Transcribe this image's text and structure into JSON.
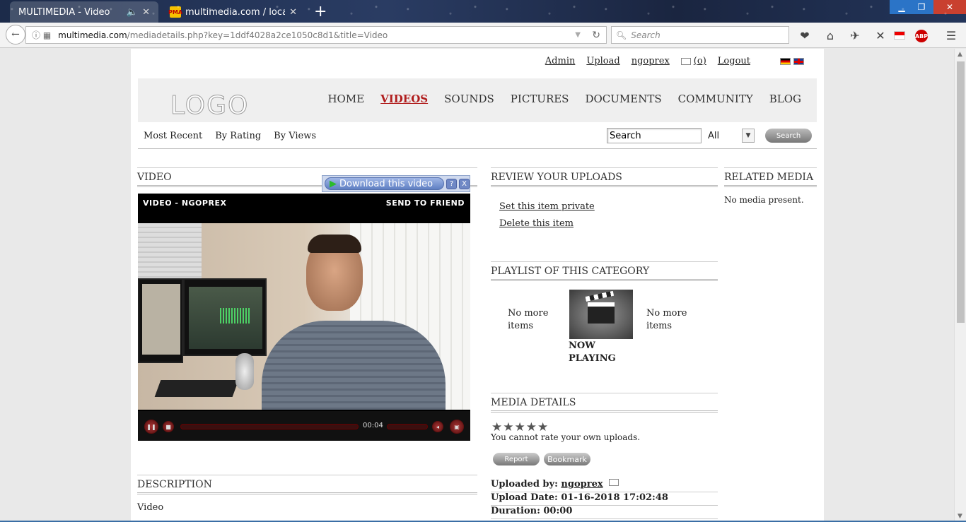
{
  "browser": {
    "tabs": [
      {
        "title": "MULTIMEDIA - Video",
        "active": true
      },
      {
        "title": "multimedia.com / localhost",
        "active": false
      }
    ],
    "url_domain": "multimedia.com",
    "url_path": "/mediadetails.php?key=1ddf4028a2ce1050c8d1&title=Video",
    "search_placeholder": "Search",
    "favicon_text": "PMA"
  },
  "top_links": {
    "admin": "Admin",
    "upload": "Upload",
    "user": "ngoprex",
    "messages": "(o)",
    "logout": "Logout"
  },
  "header": {
    "logo": "LOGO",
    "nav": [
      "HOME",
      "VIDEOS",
      "SOUNDS",
      "PICTURES",
      "DOCUMENTS",
      "COMMUNITY",
      "BLOG"
    ],
    "active_nav": "VIDEOS"
  },
  "subnav": {
    "links": [
      "Most Recent",
      "By Rating",
      "By Views"
    ],
    "search_value": "Search",
    "filter_value": "All",
    "search_button": "Search"
  },
  "video": {
    "section_title": "VIDEO",
    "download_label": "Download this video",
    "help_label": "?",
    "close_label": "X",
    "player_title": "VIDEO - NGOPREX",
    "send_to_friend": "SEND TO FRIEND",
    "time": "00:04"
  },
  "description": {
    "title": "DESCRIPTION",
    "text": "Video"
  },
  "review": {
    "title": "REVIEW YOUR UPLOADS",
    "private_link": "Set this item private",
    "delete_link": "Delete this item"
  },
  "playlist": {
    "title": "PLAYLIST OF THIS CATEGORY",
    "prev": "No more items",
    "now_playing": "NOW PLAYING",
    "next": "No more items"
  },
  "media_details": {
    "title": "MEDIA DETAILS",
    "rating_stars": 5,
    "no_rate": "You cannot rate your own uploads.",
    "report": "Report",
    "bookmark": "Bookmark",
    "uploaded_by_label": "Uploaded by:",
    "uploaded_by": "ngoprex",
    "upload_date": "Upload Date: 01-16-2018 17:02:48",
    "duration": "Duration: 00:00"
  },
  "related": {
    "title": "RELATED MEDIA",
    "empty": "No media present."
  },
  "colors": {
    "active_nav": "#b01d1d",
    "header_bg": "#efefef"
  }
}
